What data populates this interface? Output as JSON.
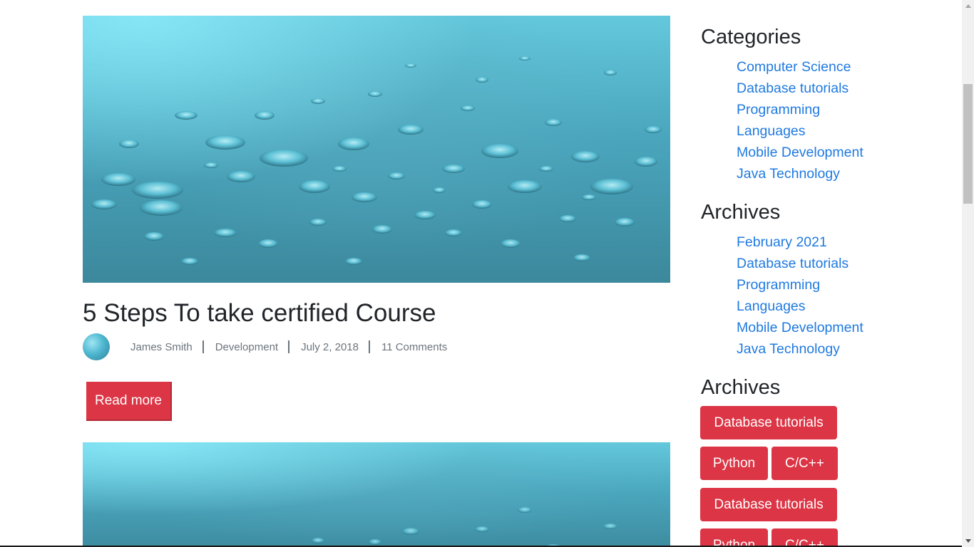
{
  "posts": [
    {
      "title": "5 Steps To take certified Course",
      "author": "James Smith",
      "category": "Development",
      "date": "July 2, 2018",
      "comments": "11 Comments",
      "read_more_label": "Read more"
    }
  ],
  "sidebar": {
    "categories": {
      "title": "Categories",
      "items": [
        "Computer Science",
        "Database tutorials",
        "Programming",
        "Languages",
        "Mobile Development",
        "Java Technology"
      ]
    },
    "archives": {
      "title": "Archives",
      "items": [
        "February 2021",
        "Database tutorials",
        "Programming",
        "Languages",
        "Mobile Development",
        "Java Technology"
      ]
    },
    "tags": {
      "title": "Archives",
      "items": [
        "Database tutorials",
        "Python",
        "C/C++",
        "Database tutorials",
        "Python",
        "C/C++"
      ]
    }
  },
  "colors": {
    "link": "#1f7ae0",
    "button": "#dc3545",
    "meta_text": "#6c757d"
  },
  "icons": {
    "scroll_up": "chevron-up-icon",
    "scroll_down": "chevron-down-icon"
  }
}
